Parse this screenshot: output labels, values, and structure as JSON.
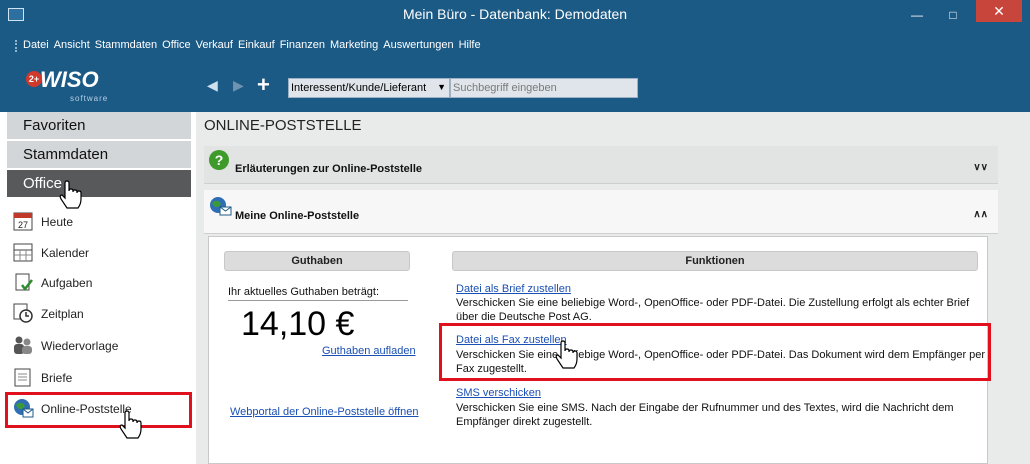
{
  "window": {
    "title": "Mein Büro - Datenbank: Demodaten"
  },
  "menu": [
    "Datei",
    "Ansicht",
    "Stammdaten",
    "Office",
    "Verkauf",
    "Einkauf",
    "Finanzen",
    "Marketing",
    "Auswertungen",
    "Hilfe"
  ],
  "logo": {
    "badge": "2+",
    "word": "WISO",
    "sub": "software"
  },
  "toolbar": {
    "search_scope": "Interessent/Kunde/Lieferant",
    "search_placeholder": "Suchbegriff eingeben"
  },
  "sidebar": {
    "headers": [
      "Favoriten",
      "Stammdaten",
      "Office"
    ],
    "items": [
      {
        "label": "Heute",
        "icon": "calendar-day-icon"
      },
      {
        "label": "Kalender",
        "icon": "calendar-icon"
      },
      {
        "label": "Aufgaben",
        "icon": "tasks-icon"
      },
      {
        "label": "Zeitplan",
        "icon": "clock-icon"
      },
      {
        "label": "Wiedervorlage",
        "icon": "people-icon"
      },
      {
        "label": "Briefe",
        "icon": "letter-icon"
      },
      {
        "label": "Online-Poststelle",
        "icon": "globe-mail-icon"
      }
    ]
  },
  "main": {
    "title": "ONLINE-POSTSTELLE",
    "panel_help": "Erläuterungen zur Online-Poststelle",
    "panel_post": "Meine Online-Poststelle",
    "guthaben": {
      "header": "Guthaben",
      "label": "Ihr aktuelles Guthaben beträgt:",
      "amount": "14,10 €",
      "topup_link": "Guthaben aufladen",
      "portal_link": "Webportal der Online-Poststelle öffnen"
    },
    "funktionen": {
      "header": "Funktionen",
      "items": [
        {
          "link": "Datei als Brief zustellen",
          "desc1": "Verschicken Sie eine beliebige Word-, OpenOffice- oder PDF-Datei. Die Zustellung erfolgt als echter Brief",
          "desc2": "über die Deutsche Post AG."
        },
        {
          "link": "Datei als Fax zustellen",
          "desc1": "Verschicken Sie eine beliebige Word-, OpenOffice- oder PDF-Datei. Das Dokument wird dem Empfänger per",
          "desc2": "Fax zugestellt."
        },
        {
          "link": "SMS verschicken",
          "desc1": "Verschicken Sie eine SMS. Nach der Eingabe der Rufnummer und des Textes, wird die Nachricht dem",
          "desc2": "Empfänger direkt zugestellt."
        }
      ]
    }
  },
  "colors": {
    "window": "#1c5a86",
    "highlight": "#e0111d",
    "link": "#1a4fb3"
  }
}
